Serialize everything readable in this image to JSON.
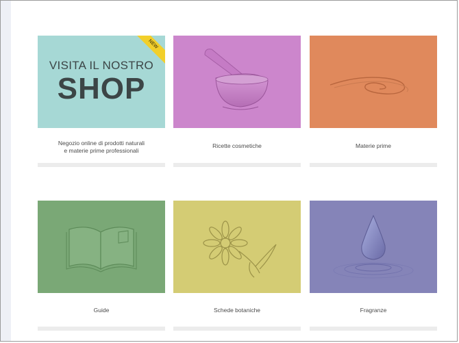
{
  "cards": [
    {
      "title_small": "VISITA IL NOSTRO",
      "title_big": "SHOP",
      "badge": "NEW",
      "caption_line1": "Negozio online di prodotti naturali",
      "caption_line2": "e materie prime professionali",
      "color": "#a6d8d5"
    },
    {
      "caption": "Ricette cosmetiche",
      "color": "#cc86cc",
      "icon": "mortar-pestle-icon"
    },
    {
      "caption": "Materie prime",
      "color": "#e0895c",
      "icon": "swirl-icon"
    },
    {
      "caption": "Guide",
      "color": "#7aa876",
      "icon": "open-book-icon"
    },
    {
      "caption": "Schede botaniche",
      "color": "#d4cc74",
      "icon": "flower-icon"
    },
    {
      "caption": "Fragranze",
      "color": "#8584b8",
      "icon": "water-drop-icon"
    }
  ]
}
